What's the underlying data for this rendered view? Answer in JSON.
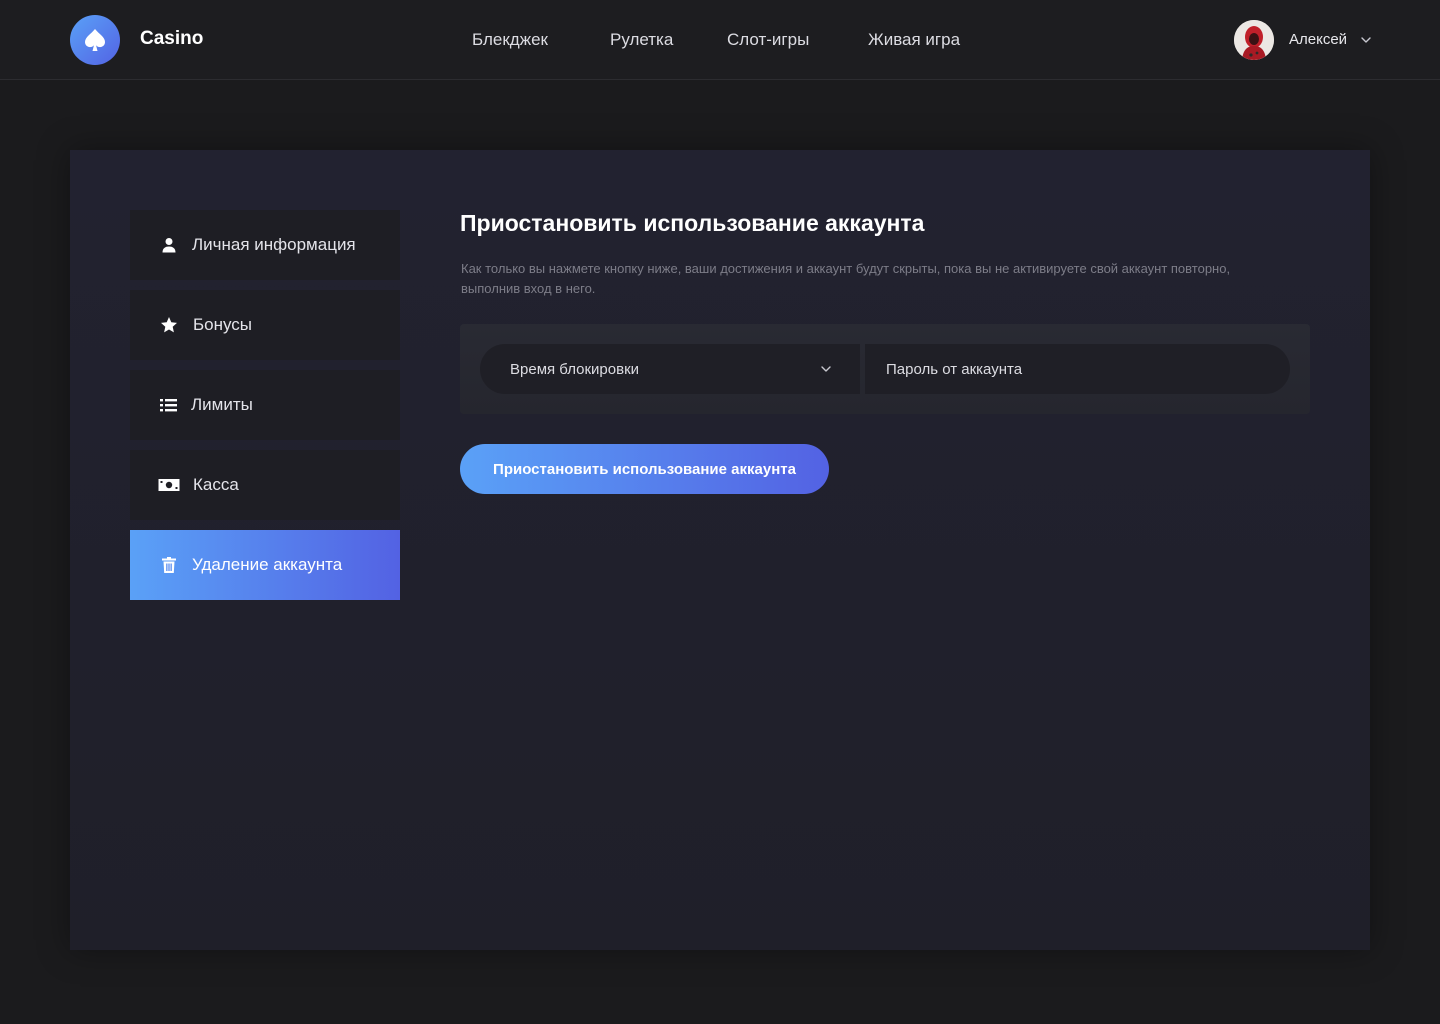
{
  "header": {
    "logo_icon": "spade-icon",
    "logo_text": "Casino",
    "nav": [
      {
        "label": "Блекджек"
      },
      {
        "label": "Рулетка"
      },
      {
        "label": "Слот-игры"
      },
      {
        "label": "Живая игра"
      }
    ],
    "user": {
      "name": "Алексей",
      "menu_icon": "chevron-down-icon"
    }
  },
  "sidebar": {
    "items": [
      {
        "label": "Личная информация",
        "icon": "user-icon",
        "active": false
      },
      {
        "label": "Бонусы",
        "icon": "star-icon",
        "active": false
      },
      {
        "label": "Лимиты",
        "icon": "list-icon",
        "active": false
      },
      {
        "label": "Касса",
        "icon": "cash-icon",
        "active": false
      },
      {
        "label": "Удаление аккаунта",
        "icon": "trash-icon",
        "active": true
      }
    ]
  },
  "main": {
    "title": "Приостановить использование аккаунта",
    "description": "Как только вы нажмете кнопку ниже, ваши достижения и аккаунт будут скрыты, пока вы не активируете свой аккаунт повторно, выполнив вход в него.",
    "form": {
      "lock_time_select": "Время блокировки",
      "password_placeholder": "Пароль от аккаунта"
    },
    "submit_label": "Приостановить использование аккаунта"
  },
  "colors": {
    "background": "#1b1b1d",
    "panel": "#222230",
    "accent_start": "#5aa1f7",
    "accent_end": "#5362e3",
    "muted_text": "#7d7d88"
  }
}
